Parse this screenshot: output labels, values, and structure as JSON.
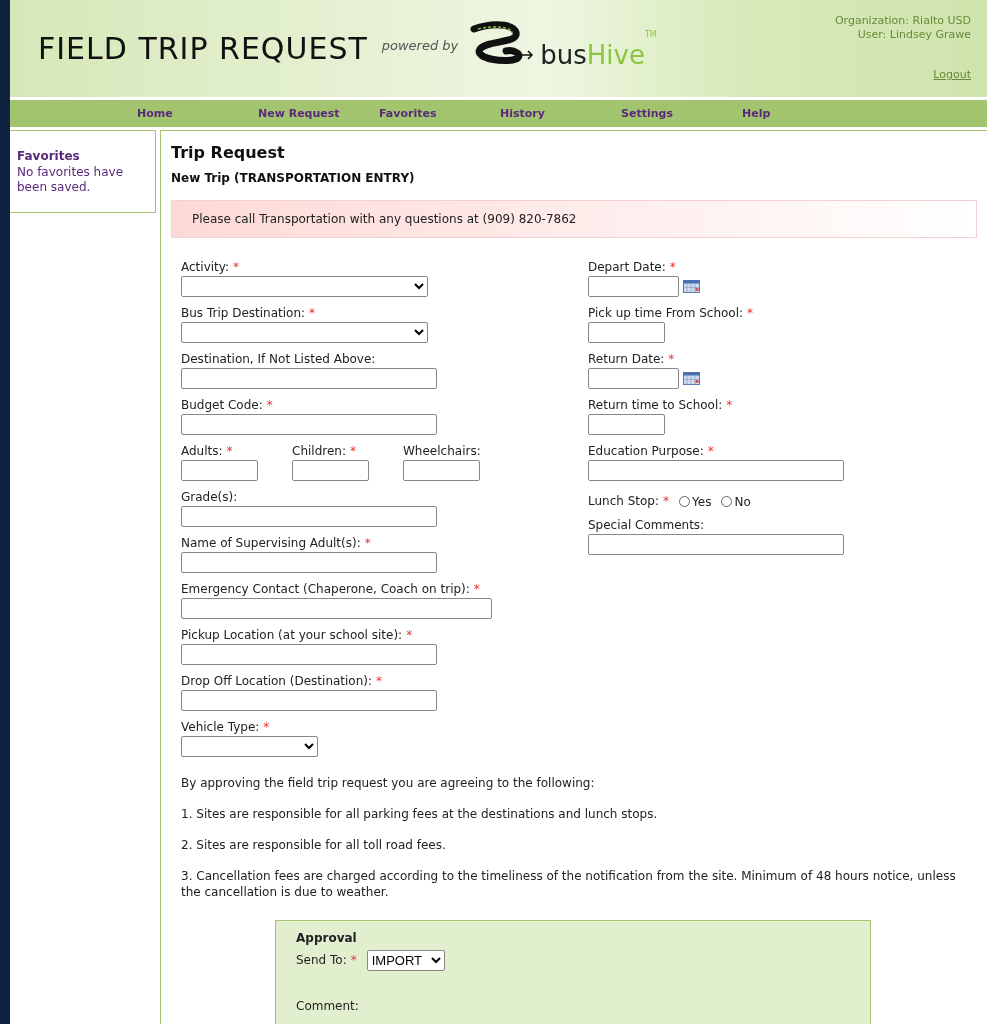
{
  "header": {
    "title": "FIELD TRIP REQUEST",
    "powered_by": "powered by",
    "logo_text": [
      "bus",
      "Hive"
    ],
    "trademark": "TM",
    "organization": "Organization: Rialto USD",
    "user": "User: Lindsey Grawe",
    "logout": "Logout"
  },
  "nav": [
    "Home",
    "New Request",
    "Favorites",
    "History",
    "Settings",
    "Help"
  ],
  "sidebar": {
    "title": "Favorites",
    "text": "No favorites have been saved."
  },
  "page": {
    "title": "Trip Request",
    "subtitle": "New Trip (TRANSPORTATION ENTRY)",
    "notice": "Please call Transportation with any questions at (909) 820-7862"
  },
  "form_left": [
    {
      "kind": "select",
      "label": "Activity:",
      "required": "*"
    },
    {
      "kind": "select",
      "label": "Bus Trip Destination:",
      "required": "*"
    },
    {
      "kind": "text",
      "label": "Destination, If Not Listed Above:"
    },
    {
      "kind": "text",
      "label": "Budget Code:",
      "required": "*"
    },
    {
      "kind": "row",
      "fields": [
        {
          "kind": "short",
          "label": "Adults:",
          "required": "*"
        },
        {
          "kind": "short",
          "label": "Children:",
          "required": "*"
        },
        {
          "kind": "short",
          "label": "Wheelchairs:"
        }
      ]
    },
    {
      "kind": "text",
      "label": "Grade(s):"
    },
    {
      "kind": "text",
      "label": "Name of Supervising Adult(s):",
      "required": "*"
    },
    {
      "kind": "long",
      "label": "Emergency Contact (Chaperone, Coach on trip):",
      "required": "*"
    },
    {
      "kind": "text",
      "label": "Pickup Location (at your school site):",
      "required": "*"
    },
    {
      "kind": "text",
      "label": "Drop Off Location (Destination):",
      "required": "*"
    },
    {
      "kind": "small-select",
      "label": "Vehicle Type:",
      "required": "*"
    }
  ],
  "form_right": [
    {
      "kind": "date",
      "label": "Depart Date:",
      "required": "*"
    },
    {
      "kind": "short",
      "label": "Pick up time From School:",
      "required": "*"
    },
    {
      "kind": "date",
      "label": "Return Date:",
      "required": "*"
    },
    {
      "kind": "short",
      "label": "Return time to School:",
      "required": "*"
    },
    {
      "kind": "text",
      "label": "Education Purpose:",
      "required": "*"
    },
    {
      "kind": "radio",
      "label": "Lunch Stop:",
      "required": "*",
      "options": [
        {
          "label": "Yes",
          "selected": false
        },
        {
          "label": "No",
          "selected": false
        }
      ]
    },
    {
      "kind": "text",
      "label": "Special Comments:"
    }
  ],
  "terms": [
    "By approving the field trip request you are agreeing to the following:",
    "1. Sites are responsible for all parking fees at the destinations and lunch stops.",
    "2. Sites are responsible for all toll road fees.",
    "3. Cancellation fees are charged according to the timeliness of the notification from the site. Minimum of 48 hours notice, unless the cancellation is due to weather."
  ],
  "approval": {
    "title": "Approval",
    "send_to_label": "Send To:",
    "send_to_required": "*",
    "send_to_value": "IMPORT",
    "comment_label": "Comment:"
  }
}
